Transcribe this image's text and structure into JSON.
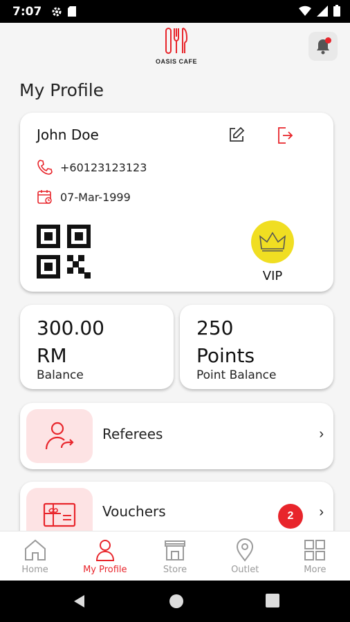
{
  "status_bar": {
    "time": "7:07"
  },
  "header": {
    "brand": "OASIS CAFE"
  },
  "page_title": "My Profile",
  "profile": {
    "name": "John Doe",
    "phone": "+60123123123",
    "dob": "07-Mar-1999",
    "tier": "VIP"
  },
  "balances": [
    {
      "value_line1": "300.00",
      "value_line2": "RM",
      "label": "Balance"
    },
    {
      "value_line1": "250",
      "value_line2": "Points",
      "label": "Point Balance"
    }
  ],
  "menu": [
    {
      "label": "Referees",
      "icon": "user-share-icon"
    },
    {
      "label": "Vouchers",
      "icon": "voucher-icon",
      "badge": "2"
    }
  ],
  "bottom_nav": [
    {
      "label": "Home",
      "icon": "home-icon",
      "active": false
    },
    {
      "label": "My Profile",
      "icon": "user-icon",
      "active": true
    },
    {
      "label": "Store",
      "icon": "store-icon",
      "active": false
    },
    {
      "label": "Outlet",
      "icon": "location-pin-icon",
      "active": false
    },
    {
      "label": "More",
      "icon": "grid-icon",
      "active": false
    }
  ],
  "colors": {
    "accent": "#e8252b",
    "vip": "#f0de22",
    "icon_bg": "#fde3e4"
  }
}
